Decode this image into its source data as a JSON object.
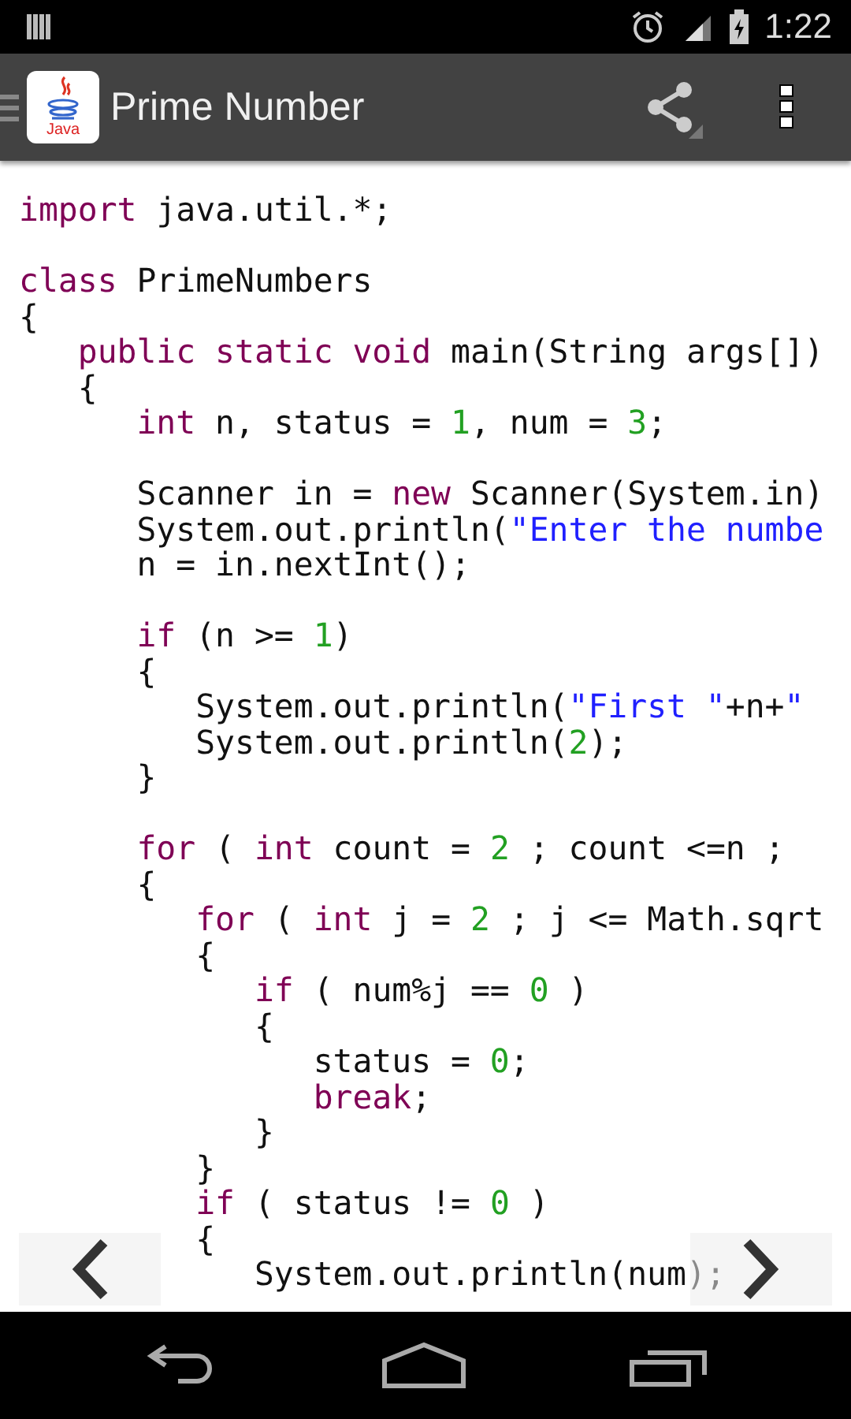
{
  "status_bar": {
    "time": "1:22"
  },
  "app_bar": {
    "title": "Prime Number",
    "logo_text": "Java"
  },
  "code": [
    {
      "kind": "code",
      "tokens": [
        {
          "kind": "keyword",
          "text": "import"
        },
        {
          "kind": "plain",
          "text": " java.util.*;"
        }
      ]
    },
    {
      "kind": "blank"
    },
    {
      "kind": "code",
      "tokens": [
        {
          "kind": "keyword",
          "text": "class"
        },
        {
          "kind": "plain",
          "text": " PrimeNumbers"
        }
      ]
    },
    {
      "kind": "code",
      "tokens": [
        {
          "kind": "plain",
          "text": "{"
        }
      ]
    },
    {
      "kind": "code",
      "tokens": [
        {
          "kind": "keyword",
          "text": "   public static void"
        },
        {
          "kind": "plain",
          "text": " main(String args[])"
        }
      ]
    },
    {
      "kind": "code",
      "tokens": [
        {
          "kind": "plain",
          "text": "   {"
        }
      ]
    },
    {
      "kind": "code",
      "tokens": [
        {
          "kind": "keyword",
          "text": "      int"
        },
        {
          "kind": "plain",
          "text": " n, status = "
        },
        {
          "kind": "number",
          "text": "1"
        },
        {
          "kind": "plain",
          "text": ", num = "
        },
        {
          "kind": "number",
          "text": "3"
        },
        {
          "kind": "plain",
          "text": ";"
        }
      ]
    },
    {
      "kind": "blank"
    },
    {
      "kind": "code",
      "tokens": [
        {
          "kind": "plain",
          "text": "      Scanner in = "
        },
        {
          "kind": "keyword",
          "text": "new"
        },
        {
          "kind": "plain",
          "text": " Scanner(System.in)"
        }
      ]
    },
    {
      "kind": "code",
      "tokens": [
        {
          "kind": "plain",
          "text": "      System.out.println("
        },
        {
          "kind": "string",
          "text": "\"Enter the numbe"
        }
      ]
    },
    {
      "kind": "code",
      "tokens": [
        {
          "kind": "plain",
          "text": "      n = in.nextInt();"
        }
      ]
    },
    {
      "kind": "blank"
    },
    {
      "kind": "code",
      "tokens": [
        {
          "kind": "keyword",
          "text": "      if"
        },
        {
          "kind": "plain",
          "text": " (n >= "
        },
        {
          "kind": "number",
          "text": "1"
        },
        {
          "kind": "plain",
          "text": ")"
        }
      ]
    },
    {
      "kind": "code",
      "tokens": [
        {
          "kind": "plain",
          "text": "      {"
        }
      ]
    },
    {
      "kind": "code",
      "tokens": [
        {
          "kind": "plain",
          "text": "         System.out.println("
        },
        {
          "kind": "string",
          "text": "\"First \""
        },
        {
          "kind": "plain",
          "text": "+n+"
        },
        {
          "kind": "string",
          "text": "\""
        }
      ]
    },
    {
      "kind": "code",
      "tokens": [
        {
          "kind": "plain",
          "text": "         System.out.println("
        },
        {
          "kind": "number",
          "text": "2"
        },
        {
          "kind": "plain",
          "text": ");"
        }
      ]
    },
    {
      "kind": "code",
      "tokens": [
        {
          "kind": "plain",
          "text": "      }"
        }
      ]
    },
    {
      "kind": "blank"
    },
    {
      "kind": "code",
      "tokens": [
        {
          "kind": "keyword",
          "text": "      for"
        },
        {
          "kind": "plain",
          "text": " ( "
        },
        {
          "kind": "keyword",
          "text": "int"
        },
        {
          "kind": "plain",
          "text": " count = "
        },
        {
          "kind": "number",
          "text": "2"
        },
        {
          "kind": "plain",
          "text": " ; count <=n ;"
        }
      ]
    },
    {
      "kind": "code",
      "tokens": [
        {
          "kind": "plain",
          "text": "      {"
        }
      ]
    },
    {
      "kind": "code",
      "tokens": [
        {
          "kind": "keyword",
          "text": "         for"
        },
        {
          "kind": "plain",
          "text": " ( "
        },
        {
          "kind": "keyword",
          "text": "int"
        },
        {
          "kind": "plain",
          "text": " j = "
        },
        {
          "kind": "number",
          "text": "2"
        },
        {
          "kind": "plain",
          "text": " ; j <= Math.sqrt"
        }
      ]
    },
    {
      "kind": "code",
      "tokens": [
        {
          "kind": "plain",
          "text": "         {"
        }
      ]
    },
    {
      "kind": "code",
      "tokens": [
        {
          "kind": "keyword",
          "text": "            if"
        },
        {
          "kind": "plain",
          "text": " ( num%j == "
        },
        {
          "kind": "number",
          "text": "0"
        },
        {
          "kind": "plain",
          "text": " )"
        }
      ]
    },
    {
      "kind": "code",
      "tokens": [
        {
          "kind": "plain",
          "text": "            {"
        }
      ]
    },
    {
      "kind": "code",
      "tokens": [
        {
          "kind": "plain",
          "text": "               status = "
        },
        {
          "kind": "number",
          "text": "0"
        },
        {
          "kind": "plain",
          "text": ";"
        }
      ]
    },
    {
      "kind": "code",
      "tokens": [
        {
          "kind": "keyword",
          "text": "               break"
        },
        {
          "kind": "plain",
          "text": ";"
        }
      ]
    },
    {
      "kind": "code",
      "tokens": [
        {
          "kind": "plain",
          "text": "            }"
        }
      ]
    },
    {
      "kind": "code",
      "tokens": [
        {
          "kind": "plain",
          "text": "         }"
        }
      ]
    },
    {
      "kind": "code",
      "tokens": [
        {
          "kind": "keyword",
          "text": "         if"
        },
        {
          "kind": "plain",
          "text": " ( status != "
        },
        {
          "kind": "number",
          "text": "0"
        },
        {
          "kind": "plain",
          "text": " )"
        }
      ]
    },
    {
      "kind": "code",
      "tokens": [
        {
          "kind": "plain",
          "text": "         {"
        }
      ]
    },
    {
      "kind": "code",
      "tokens": [
        {
          "kind": "plain",
          "text": "            System.out.println(num);"
        }
      ]
    }
  ]
}
